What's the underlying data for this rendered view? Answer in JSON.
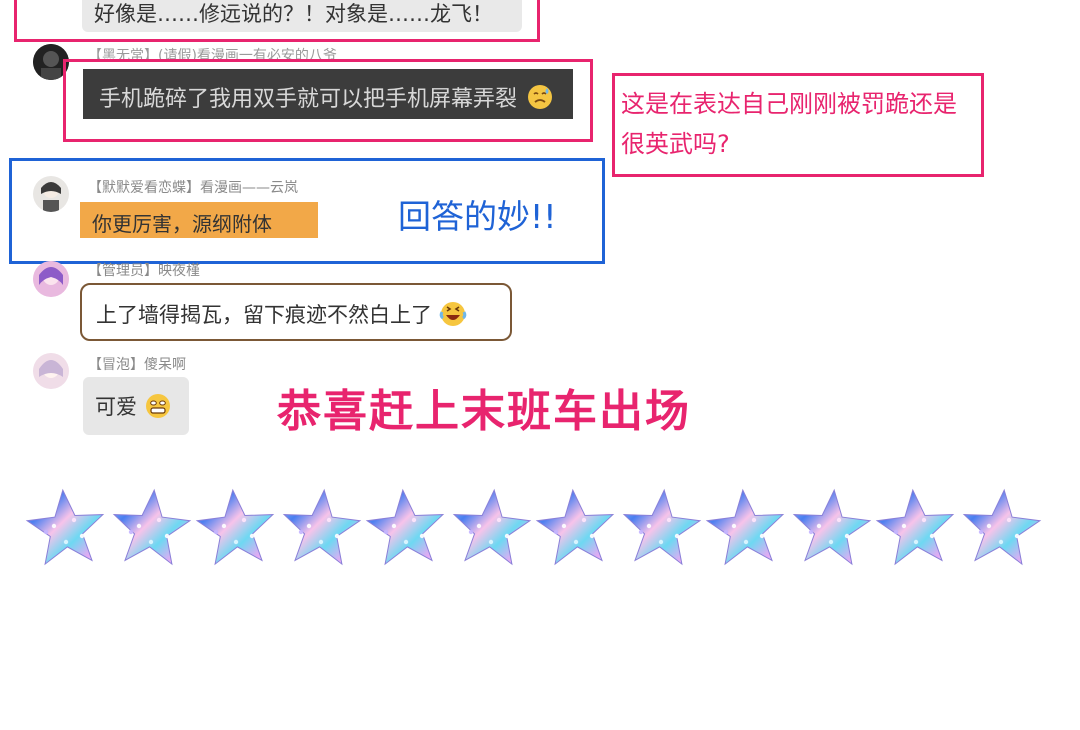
{
  "comments": [
    {
      "text": "好像是……修远说的？！对象是……龙飞！",
      "bubble_color": "#e9e9e9",
      "text_color": "#333333",
      "highlight_color": "#e8246e"
    },
    {
      "username": "【黑无常】(请假)看漫画一有必安的八爷",
      "text": "手机跪碎了我用双手就可以把手机屏幕弄裂",
      "emoji": "sweat-face",
      "bubble_color": "#3c3c3c",
      "text_color": "#d8d8d8",
      "highlight_color": "#e8246e"
    },
    {
      "username": "【默默爱看恋蝶】看漫画——云岚",
      "text": "你更厉害，源纲附体",
      "bubble_color": "#f2a848",
      "text_color": "#333333",
      "highlight_color": "#1f63d6"
    },
    {
      "username": "【管理员】映夜槿",
      "text": "上了墙得揭瓦，留下痕迹不然白上了",
      "emoji": "laughing-crying-face",
      "bubble_color": "#ffffff",
      "bubble_border": "#7b5836"
    },
    {
      "username": "【冒泡】傻呆啊",
      "text": "可爱",
      "emoji": "grin-face",
      "bubble_color": "#e7e7e7"
    }
  ],
  "annotations": {
    "question": "这是在表达自己刚刚被罚跪还是很英武吗?",
    "question_color": "#e8246e",
    "praise": "回答的妙!!",
    "praise_color": "#1f63d6",
    "congrats": "恭喜赶上末班车出场",
    "congrats_color": "#e8246e"
  },
  "decoration": {
    "star_count": 12,
    "star_icon": "galaxy-star-icon"
  }
}
